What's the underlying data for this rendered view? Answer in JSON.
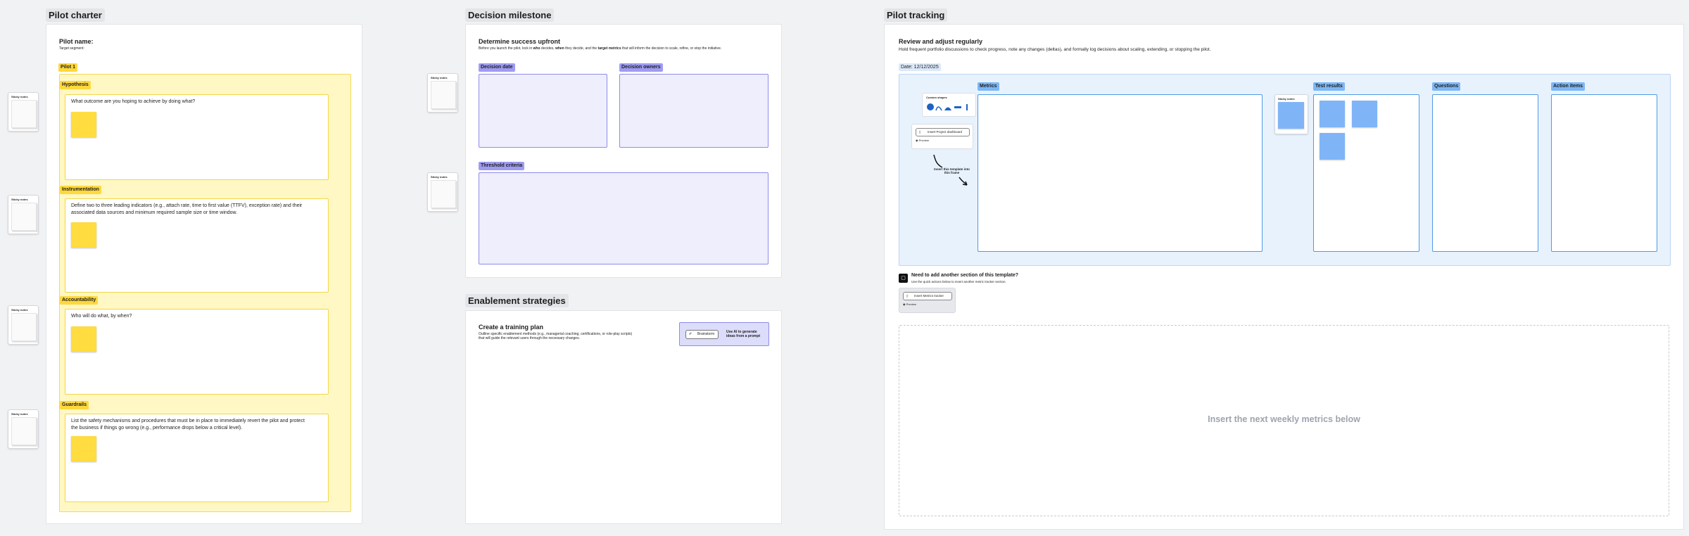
{
  "charter": {
    "section_title": "Pilot charter",
    "pilot_name": "Pilot name:",
    "target_segment": "Target segment:",
    "pilot_tag": "Pilot 1",
    "blocks": [
      {
        "tag": "Hypothesis",
        "prompt": "What outcome are you hoping to achieve by doing what?"
      },
      {
        "tag": "Instrumentation",
        "prompt": "Define two to three leading indicators (e.g., attach rate, time to first value (TTFV), exception rate) and their associated data sources and minimum required sample size or time window."
      },
      {
        "tag": "Accountability",
        "prompt": "Who will do what, by when?"
      },
      {
        "tag": "Guardrails",
        "prompt": "List the safety mechanisms and procedures that must be in place to immediately revert the pilot and protect the business if things go wrong (e.g., performance drops below a critical level)."
      }
    ],
    "sticky_label": "Sticky notes"
  },
  "decision": {
    "section_title": "Decision milestone",
    "heading": "Determine success upfront",
    "description_parts": [
      "Before you launch the pilot, lock in ",
      "who",
      " decides, ",
      "when",
      " they decide, and the ",
      "target metrics",
      " that will inform the decision to scale, refine, or stop the initiative."
    ],
    "tags": [
      "Decision date",
      "Decision owners",
      "Threshold criteria"
    ],
    "sticky_label": "Sticky notes"
  },
  "enablement": {
    "section_title": "Enablement strategies",
    "heading": "Create a training plan",
    "description": "Outline specific enablement methods (e.g., managerial coaching, certifications, or role-play scripts) that will guide the relevant users through the necessary changes.",
    "ai_button": "Brainstorm",
    "ai_hint": "Use AI to generate ideas from a prompt"
  },
  "tracking": {
    "section_title": "Pilot tracking",
    "heading": "Review and adjust regularly",
    "description": "Hold frequent portfolio discussions to check progress, note any changes (deltas), and formally log decisions about scaling, extending, or stopping the pilot.",
    "date": "Date: 12/12/2025",
    "columns": [
      "Metrics",
      "Test results",
      "Questions",
      "Action items"
    ],
    "widget_title": "Custom shapes",
    "insert_button": "Insert Project dashboard",
    "preview_label": "Preview",
    "annotation": "Insert this template into this frame",
    "sticky_label": "Sticky notes",
    "add_section_title": "Need to add another section of this template?",
    "add_section_desc": "Use the quick actions below to insert another metric tracker section.",
    "insert_metrics_button": "Insert Metrics tracker",
    "placeholder_text": "Insert the next weekly metrics below"
  },
  "colors": {
    "yellow": "#ffd83b",
    "purple": "#9f9cf2",
    "blue": "#7db7f5",
    "board": "#f1f2f4"
  }
}
